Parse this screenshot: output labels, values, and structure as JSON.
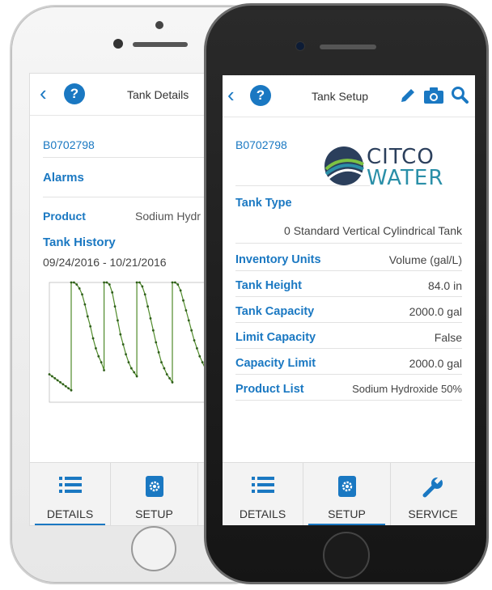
{
  "colors": {
    "accent": "#1a78c2",
    "chart_line": "#4f8a2a",
    "logo_dark": "#2b3f5c",
    "logo_teal": "#2a8fa8"
  },
  "details_screen": {
    "nav": {
      "title": "Tank Details",
      "back_icon": "chevron-left-icon",
      "help_icon": "help-icon",
      "help_glyph": "?"
    },
    "serial": "B0702798",
    "alarms_label": "Alarms",
    "product": {
      "label": "Product",
      "value": "Sodium Hydr"
    },
    "history": {
      "label": "Tank History",
      "date_range": "09/24/2016 - 10/21/2016"
    },
    "tabs": [
      {
        "label": "DETAILS",
        "icon": "list-icon",
        "active": true
      },
      {
        "label": "SETUP",
        "icon": "gear-icon",
        "active": false
      }
    ]
  },
  "chart_data": {
    "type": "line",
    "title": "",
    "xlabel": "",
    "ylabel": "",
    "x_range": [
      "09/24/2016",
      "10/21/2016"
    ],
    "ylim": [
      1400,
      2000
    ],
    "grid": false,
    "series": [
      {
        "x": [
          0,
          0.4,
          0.8,
          1.2,
          1.6,
          2.0,
          2.4,
          2.8,
          3.2,
          3.2,
          3.6,
          4.0,
          4.4,
          4.8,
          5.2,
          5.6,
          6.0,
          6.4,
          6.8,
          7.2,
          7.6,
          8.0,
          8.0,
          8.4,
          8.8,
          9.2,
          9.6,
          10.0,
          10.4,
          10.8,
          11.2,
          11.6,
          12.0,
          12.4,
          12.8,
          12.8,
          13.2,
          13.6,
          14.0,
          14.4,
          14.8,
          15.2,
          15.6,
          16.0,
          16.4,
          16.8,
          17.2,
          17.6,
          18.0,
          18.0,
          18.4,
          18.8,
          19.2,
          19.6,
          20.0,
          20.4,
          20.8,
          21.2,
          21.6,
          22.0,
          22.4,
          22.8,
          23.2,
          23.6,
          23.6,
          24.0,
          24.4,
          24.8,
          25.2,
          25.6,
          26.0,
          26.4,
          26.8,
          27.0
        ],
        "y": [
          1540,
          1530,
          1520,
          1510,
          1500,
          1490,
          1480,
          1470,
          1460,
          2000,
          2000,
          1990,
          1970,
          1940,
          1890,
          1830,
          1780,
          1720,
          1670,
          1630,
          1600,
          1560,
          2000,
          2000,
          1990,
          1950,
          1880,
          1810,
          1740,
          1690,
          1640,
          1600,
          1570,
          1550,
          1530,
          2000,
          2000,
          1980,
          1940,
          1880,
          1820,
          1760,
          1700,
          1650,
          1600,
          1570,
          1540,
          1520,
          1500,
          2000,
          2000,
          1990,
          1960,
          1910,
          1860,
          1810,
          1760,
          1710,
          1670,
          1630,
          1600,
          1570,
          1550,
          1530,
          2000,
          2000,
          1990,
          1970,
          1950,
          1920,
          1880,
          1850,
          1820,
          1800
        ]
      }
    ]
  },
  "setup_screen": {
    "nav": {
      "title": "Tank Setup",
      "back_icon": "chevron-left-icon",
      "help_icon": "help-icon",
      "help_glyph": "?",
      "edit_icon": "pencil-icon",
      "camera_icon": "camera-icon",
      "search_icon": "search-icon"
    },
    "serial": "B0702798",
    "logo": {
      "line1": "CITCO",
      "line2": "WATER"
    },
    "tank_type": {
      "label": "Tank Type",
      "value": "0 Standard Vertical Cylindrical Tank"
    },
    "fields": [
      {
        "label": "Inventory Units",
        "value": "Volume (gal/L)"
      },
      {
        "label": "Tank Height",
        "value": "84.0 in"
      },
      {
        "label": "Tank Capacity",
        "value": "2000.0 gal"
      },
      {
        "label": "Limit Capacity",
        "value": "False"
      },
      {
        "label": "Capacity Limit",
        "value": "2000.0 gal"
      },
      {
        "label": "Product List",
        "value": "Sodium Hydroxide 50%"
      }
    ],
    "tabs": [
      {
        "label": "DETAILS",
        "icon": "list-icon",
        "active": false
      },
      {
        "label": "SETUP",
        "icon": "gear-icon",
        "active": true
      },
      {
        "label": "SERVICE",
        "icon": "wrench-icon",
        "active": false
      }
    ]
  }
}
